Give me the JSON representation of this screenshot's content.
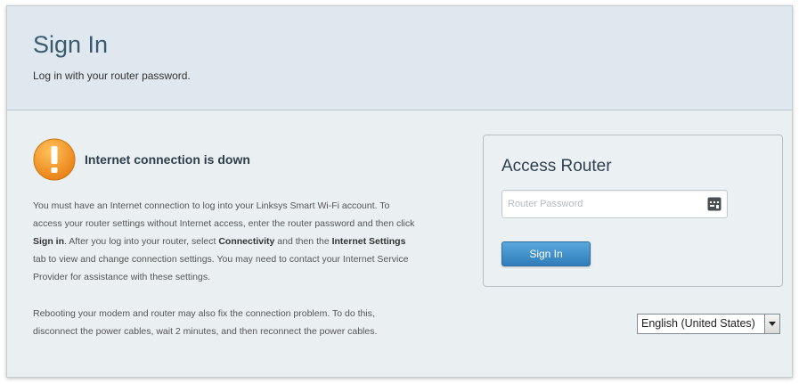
{
  "header": {
    "title": "Sign In",
    "subtitle": "Log in with your router password."
  },
  "warning": {
    "icon": "warning-exclamation-icon",
    "title": "Internet connection is down",
    "paragraph1": {
      "p1": "You must have an Internet connection to log into your Linksys Smart Wi-Fi account. To access your router settings without Internet access, enter the router password and then click ",
      "b1": "Sign in",
      "p2": ". After you log into your router, select ",
      "b2": "Connectivity",
      "p3": " and then the ",
      "b3": "Internet Settings",
      "p4": " tab to view and change connection settings. You may need to contact your Internet Service Provider for assistance with these settings."
    },
    "paragraph2": "Rebooting your modem and router may also fix the connection problem. To do this, disconnect the power cables, wait 2 minutes, and then reconnect the power cables."
  },
  "access_panel": {
    "title": "Access Router",
    "password_placeholder": "Router Password",
    "password_value": "",
    "password_icon": "keyboard-key-icon",
    "signin_label": "Sign In"
  },
  "language": {
    "selected": "English (United States)"
  },
  "colors": {
    "accent": "#2f7dbb",
    "warning": "#f39a25",
    "title": "#3c5a6f"
  }
}
